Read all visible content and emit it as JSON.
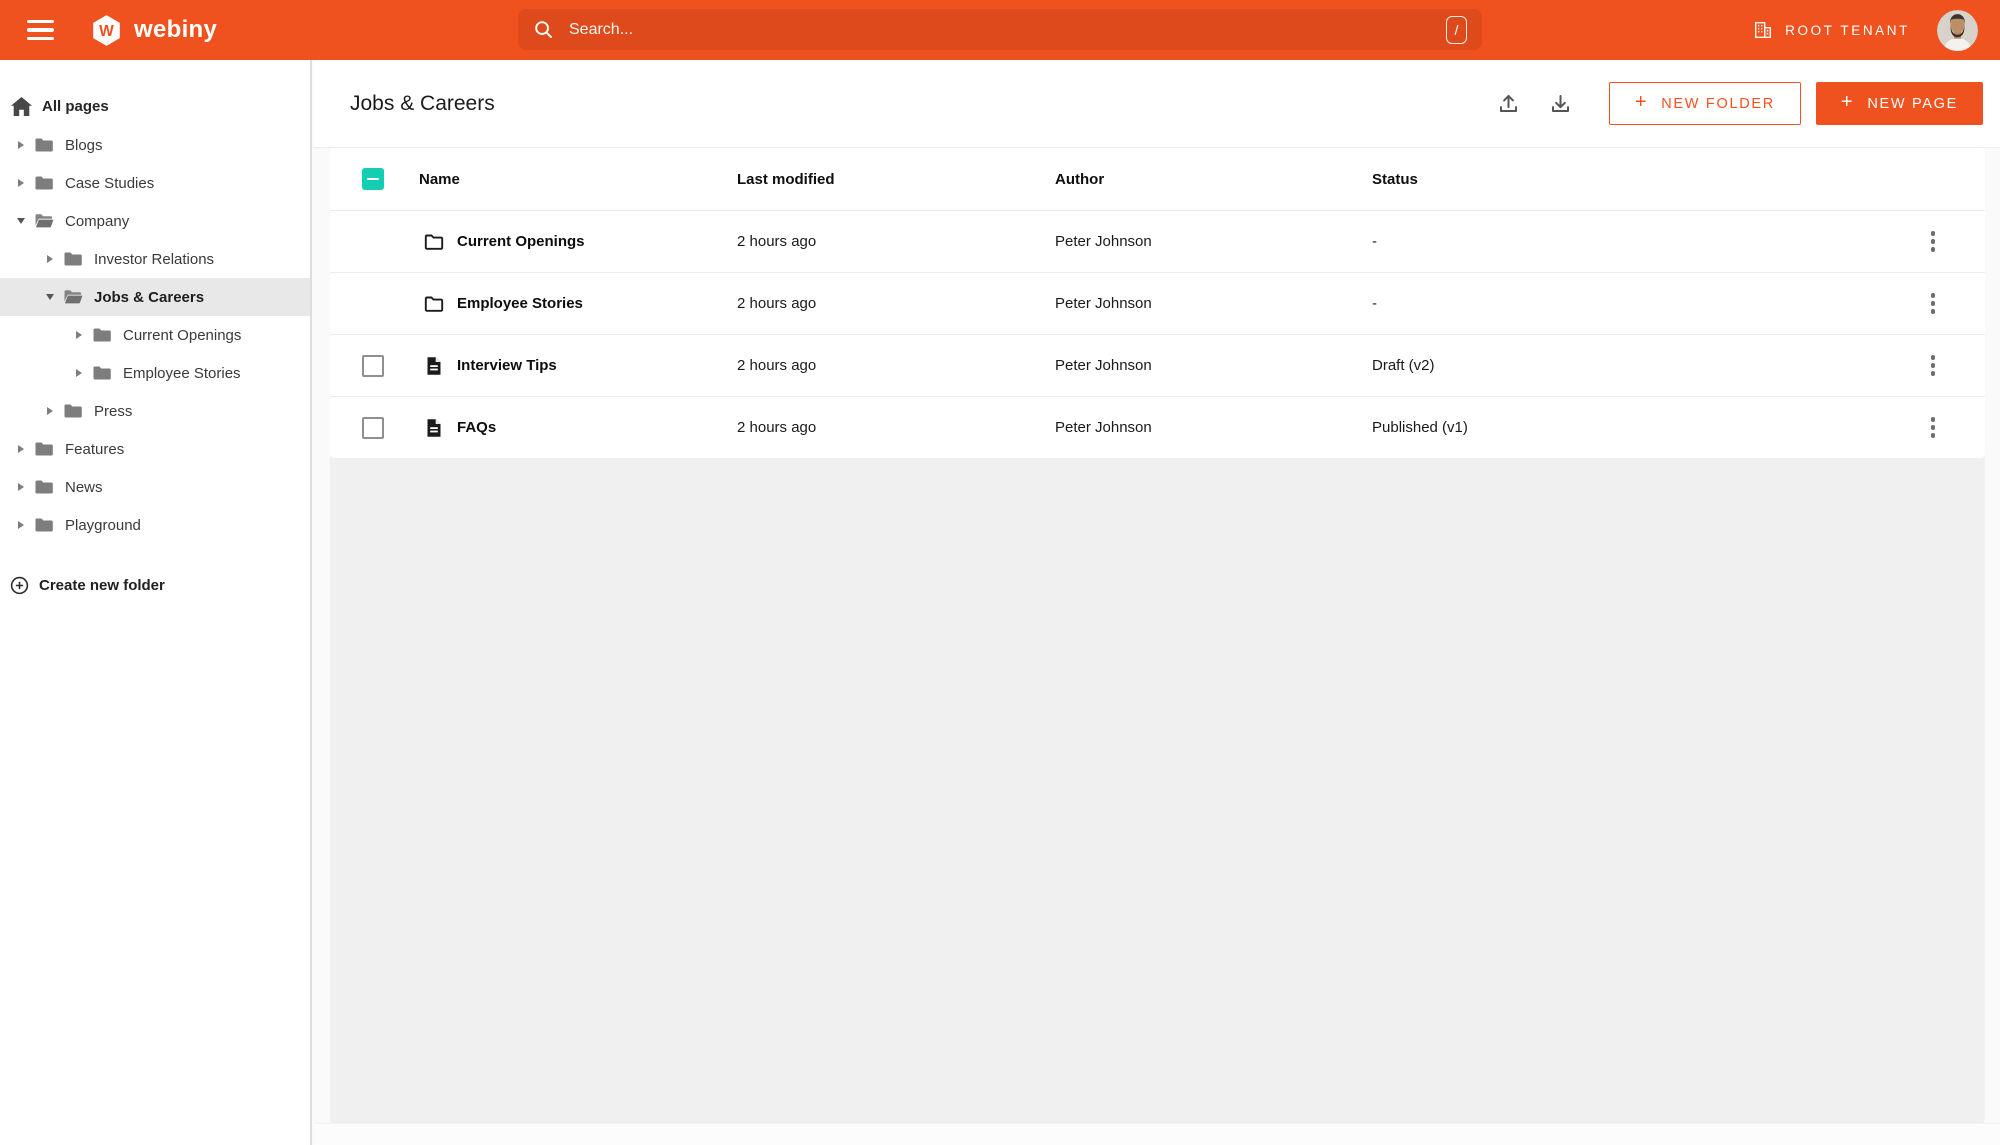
{
  "topbar": {
    "brand": "webiny",
    "search": {
      "placeholder": "Search...",
      "shortcut_key": "/"
    },
    "tenant_label": "ROOT TENANT"
  },
  "sidebar": {
    "root_label": "All pages",
    "create_label": "Create new folder",
    "items": [
      {
        "label": "Blogs",
        "level": 0,
        "state": "collapsed",
        "selected": false
      },
      {
        "label": "Case Studies",
        "level": 0,
        "state": "collapsed",
        "selected": false
      },
      {
        "label": "Company",
        "level": 0,
        "state": "expanded",
        "selected": false
      },
      {
        "label": "Investor Relations",
        "level": 1,
        "state": "collapsed",
        "selected": false
      },
      {
        "label": "Jobs & Careers",
        "level": 1,
        "state": "expanded",
        "selected": true
      },
      {
        "label": "Current Openings",
        "level": 2,
        "state": "collapsed",
        "selected": false
      },
      {
        "label": "Employee Stories",
        "level": 2,
        "state": "collapsed",
        "selected": false
      },
      {
        "label": "Press",
        "level": 1,
        "state": "collapsed",
        "selected": false
      },
      {
        "label": "Features",
        "level": 0,
        "state": "collapsed",
        "selected": false
      },
      {
        "label": "News",
        "level": 0,
        "state": "collapsed",
        "selected": false
      },
      {
        "label": "Playground",
        "level": 0,
        "state": "collapsed",
        "selected": false
      }
    ]
  },
  "main": {
    "title": "Jobs & Careers",
    "actions": {
      "new_folder_label": "NEW FOLDER",
      "new_page_label": "NEW PAGE",
      "plus": "+"
    },
    "table": {
      "select_all_state": "indeterminate",
      "headers": {
        "name": "Name",
        "modified": "Last modified",
        "author": "Author",
        "status": "Status"
      },
      "rows": [
        {
          "type": "folder",
          "name": "Current Openings",
          "modified": "2 hours ago",
          "author": "Peter Johnson",
          "status": "-",
          "has_checkbox": false,
          "checked": false
        },
        {
          "type": "folder",
          "name": "Employee Stories",
          "modified": "2 hours ago",
          "author": "Peter Johnson",
          "status": "-",
          "has_checkbox": false,
          "checked": false
        },
        {
          "type": "page",
          "name": "Interview Tips",
          "modified": "2 hours ago",
          "author": "Peter Johnson",
          "status": "Draft (v2)",
          "has_checkbox": true,
          "checked": false
        },
        {
          "type": "page",
          "name": "FAQs",
          "modified": "2 hours ago",
          "author": "Peter Johnson",
          "status": "Published (v1)",
          "has_checkbox": true,
          "checked": false
        }
      ]
    }
  },
  "icons": {
    "topbar": [
      "hamburger-menu-icon",
      "webiny-logo",
      "search-icon",
      "slash-shortcut-badge",
      "tenant-building-icon",
      "user-avatar"
    ],
    "sidebar": [
      "home-icon",
      "chevron-right-icon",
      "chevron-down-icon",
      "folder-icon",
      "folder-open-icon",
      "plus-circle-icon"
    ],
    "main": [
      "upload-icon",
      "download-icon",
      "folder-outline-icon",
      "page-document-icon",
      "kebab-menu-icon",
      "checkbox"
    ]
  },
  "colors": {
    "accent": "#f0521f",
    "search_field": "#de4a1b",
    "select_teal": "#13ceb1",
    "sidebar_selected_bg": "#e8e8e8",
    "panel_gray": "#f0f0f0",
    "row_border": "#ececec"
  }
}
